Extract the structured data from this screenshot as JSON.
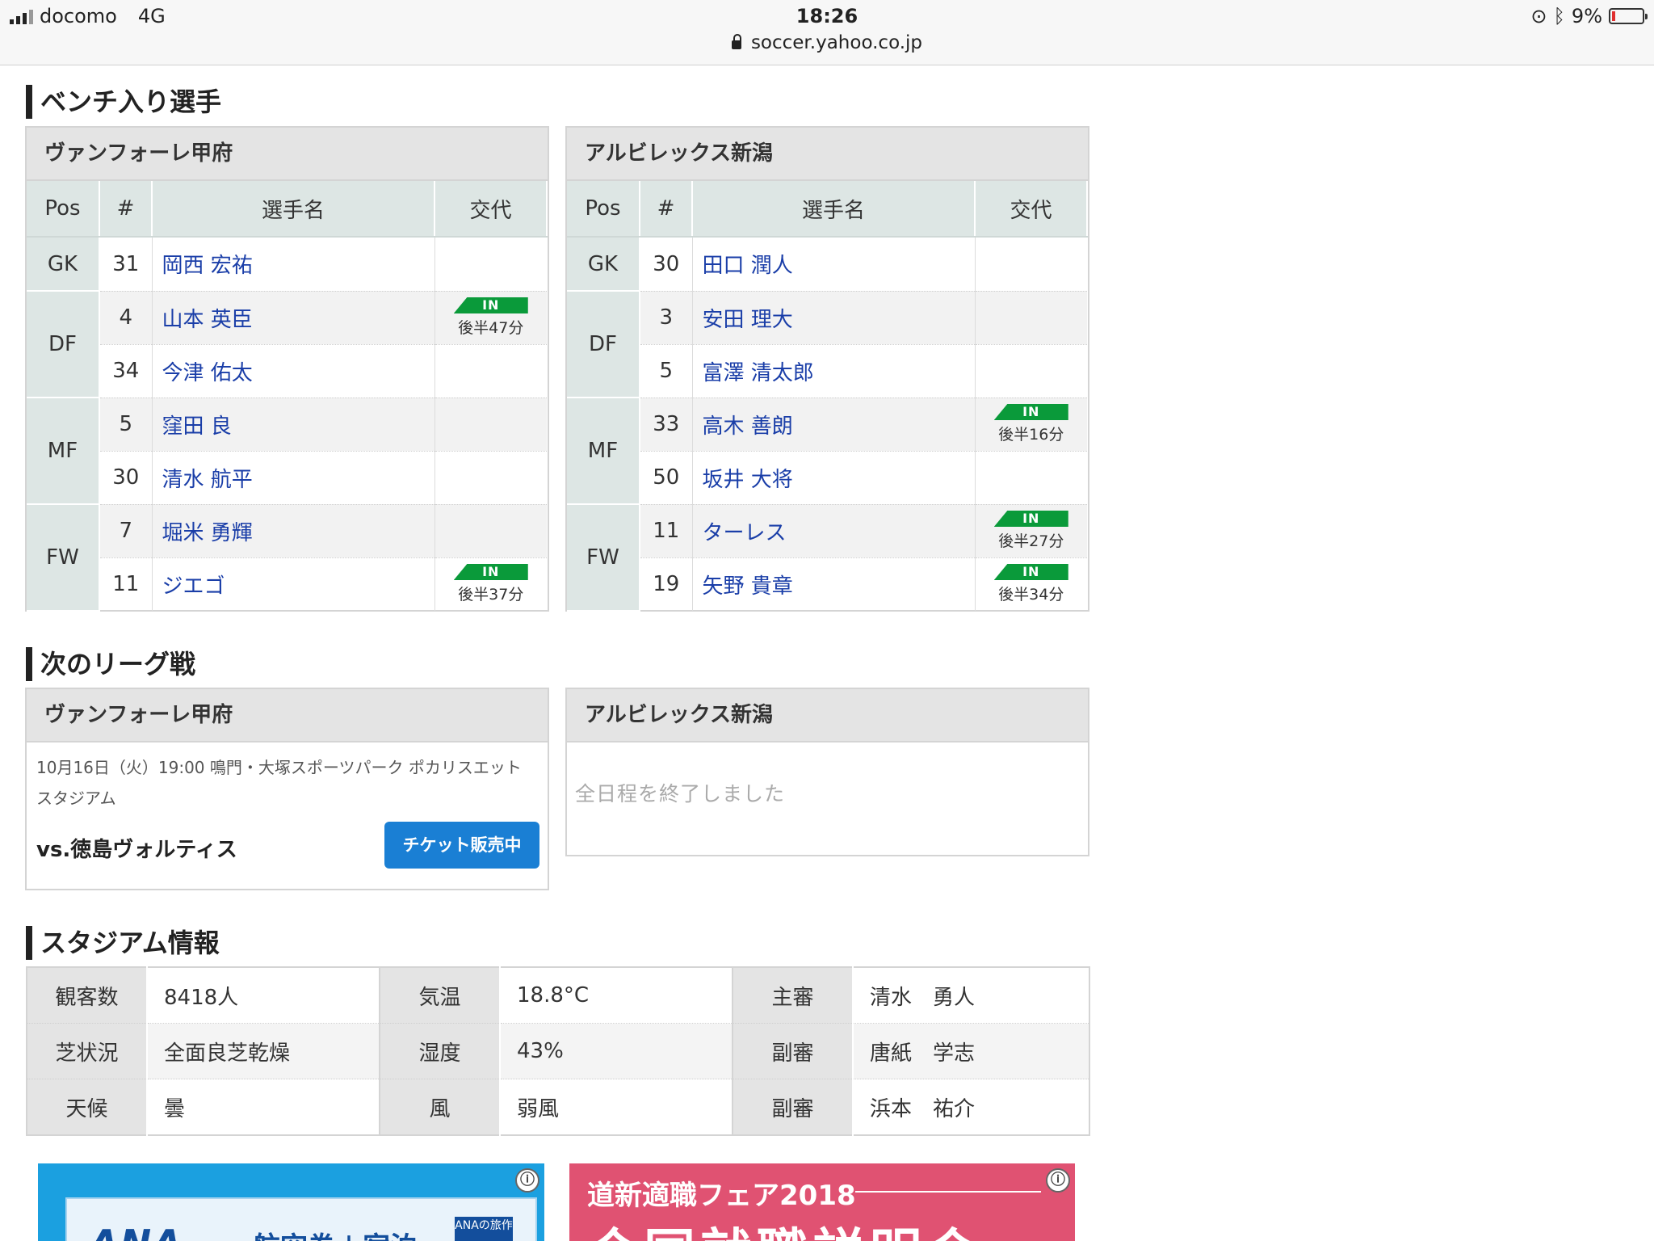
{
  "status_bar": {
    "carrier": "docomo",
    "network": "4G",
    "time": "18:26",
    "url": "soccer.yahoo.co.jp",
    "battery": "9%"
  },
  "bench": {
    "title": "ベンチ入り選手",
    "columns": {
      "pos": "Pos",
      "num": "#",
      "name": "選手名",
      "sub": "交代"
    },
    "teams": [
      {
        "name": "ヴァンフォーレ甲府",
        "groups": [
          {
            "pos": "GK",
            "players": [
              {
                "num": "31",
                "name": "岡西 宏祐",
                "in": "",
                "time": ""
              }
            ]
          },
          {
            "pos": "DF",
            "players": [
              {
                "num": "4",
                "name": "山本 英臣",
                "in": "IN",
                "time": "後半47分"
              },
              {
                "num": "34",
                "name": "今津 佑太",
                "in": "",
                "time": ""
              }
            ]
          },
          {
            "pos": "MF",
            "players": [
              {
                "num": "5",
                "name": "窪田 良",
                "in": "",
                "time": ""
              },
              {
                "num": "30",
                "name": "清水 航平",
                "in": "",
                "time": ""
              }
            ]
          },
          {
            "pos": "FW",
            "players": [
              {
                "num": "7",
                "name": "堀米 勇輝",
                "in": "",
                "time": ""
              },
              {
                "num": "11",
                "name": "ジエゴ",
                "in": "IN",
                "time": "後半37分"
              }
            ]
          }
        ]
      },
      {
        "name": "アルビレックス新潟",
        "groups": [
          {
            "pos": "GK",
            "players": [
              {
                "num": "30",
                "name": "田口 潤人",
                "in": "",
                "time": ""
              }
            ]
          },
          {
            "pos": "DF",
            "players": [
              {
                "num": "3",
                "name": "安田 理大",
                "in": "",
                "time": ""
              },
              {
                "num": "5",
                "name": "富澤 清太郎",
                "in": "",
                "time": ""
              }
            ]
          },
          {
            "pos": "MF",
            "players": [
              {
                "num": "33",
                "name": "高木 善朗",
                "in": "IN",
                "time": "後半16分"
              },
              {
                "num": "50",
                "name": "坂井 大将",
                "in": "",
                "time": ""
              }
            ]
          },
          {
            "pos": "FW",
            "players": [
              {
                "num": "11",
                "name": "ターレス",
                "in": "IN",
                "time": "後半27分"
              },
              {
                "num": "19",
                "name": "矢野 貴章",
                "in": "IN",
                "time": "後半34分"
              }
            ]
          }
        ]
      }
    ]
  },
  "next_match": {
    "title": "次のリーグ戦",
    "home": {
      "team": "ヴァンフォーレ甲府",
      "info_line1": "10月16日（火）19:00 鳴門・大塚スポーツパーク ポカリスエット",
      "info_line2": "スタジアム",
      "opponent": "vs.徳島ヴォルティス",
      "ticket_label": "チケット販売中"
    },
    "away": {
      "team": "アルビレックス新潟",
      "message": "全日程を終了しました"
    }
  },
  "stadium": {
    "title": "スタジアム情報",
    "rows": [
      [
        {
          "k": "観客数",
          "v": "8418人"
        },
        {
          "k": "気温",
          "v": "18.8°C"
        },
        {
          "k": "主審",
          "v": "清水　勇人"
        }
      ],
      [
        {
          "k": "芝状況",
          "v": "全面良芝乾燥"
        },
        {
          "k": "湿度",
          "v": "43%"
        },
        {
          "k": "副審",
          "v": "唐紙　学志"
        }
      ],
      [
        {
          "k": "天候",
          "v": "曇"
        },
        {
          "k": "風",
          "v": "弱風"
        },
        {
          "k": "副審",
          "v": "浜本　祐介"
        }
      ]
    ]
  },
  "ads": {
    "ana": {
      "logo": "ANA",
      "text": "航空券＋宿泊",
      "badge": "ANAの旅作"
    },
    "doshin": {
      "line1": "道新適職フェア2018",
      "line2": "合同就職説明会"
    },
    "info_icon": "ⓘ"
  },
  "colors": {
    "link": "#1a3ea8",
    "in_badge": "#0a9a3a",
    "ticket_button": "#1a7fd4",
    "header_gray": "#e4e4e4",
    "pos_cell": "#dde6e4"
  }
}
